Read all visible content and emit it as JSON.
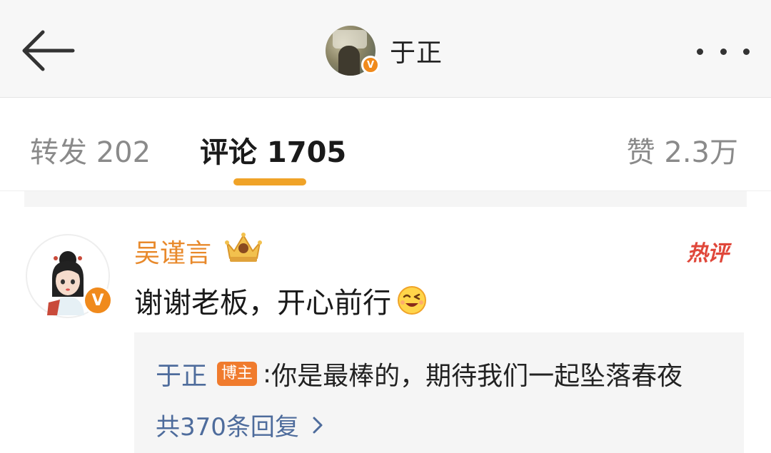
{
  "header": {
    "title": "于正",
    "verified_mark": "V",
    "back_icon": "arrow-left-icon",
    "more_icon": "more-dots-icon"
  },
  "tabs": [
    {
      "label": "转发 202"
    },
    {
      "label": "评论 1705",
      "active": true
    },
    {
      "label": "赞 2.3万"
    }
  ],
  "comment": {
    "username": "吴谨言",
    "verified_mark": "V",
    "hot_label": "热评",
    "text": "谢谢老板，开心前行",
    "emoji": "wink-emoji-icon",
    "reply": {
      "author": "于正",
      "tag": "博主",
      "colon": ":",
      "text": "你是最棒的，期待我们一起坠落春夜",
      "more": "共370条回复"
    }
  },
  "colors": {
    "accent": "#f0a328",
    "username": "#e8892b",
    "link": "#4e6c9c",
    "hot": "#e0473a",
    "verified": "#f08a1c"
  }
}
